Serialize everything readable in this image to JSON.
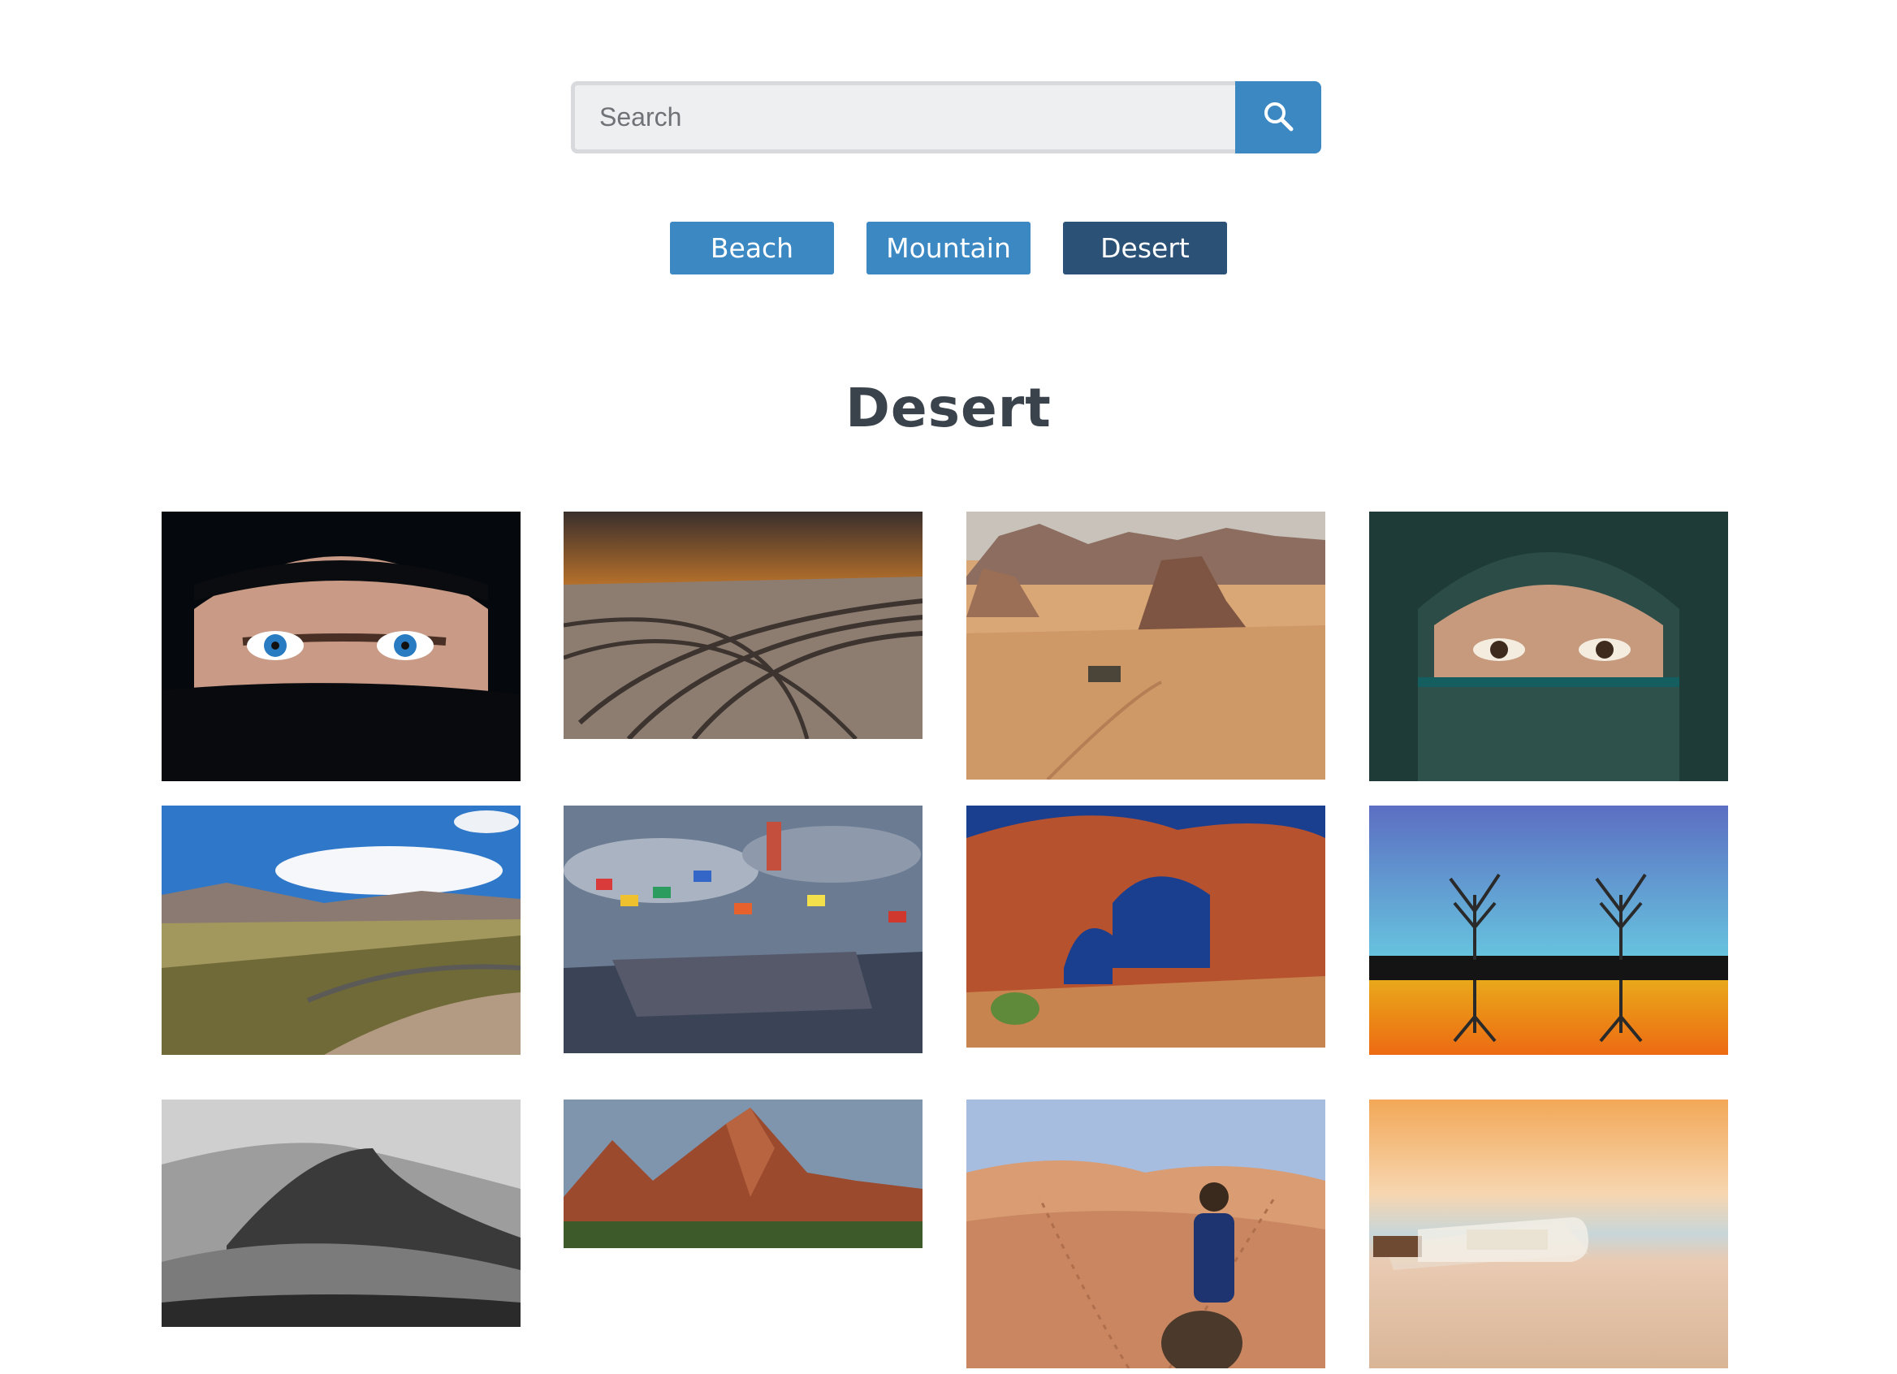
{
  "search": {
    "placeholder": "Search",
    "value": "",
    "icon": "search-icon"
  },
  "filters": [
    {
      "label": "Beach",
      "active": false
    },
    {
      "label": "Mountain",
      "active": false
    },
    {
      "label": "Desert",
      "active": true
    }
  ],
  "colors": {
    "primary": "#3b88c3",
    "active": "#2b5276",
    "heading": "#3a434c"
  },
  "gallery": {
    "title": "Desert",
    "photos": [
      {
        "name": "veiled-woman-blue-eyes"
      },
      {
        "name": "salt-flat-tire-tracks-sunset"
      },
      {
        "name": "wadi-rum-rock-formations"
      },
      {
        "name": "woman-green-niqab"
      },
      {
        "name": "andes-valley-road"
      },
      {
        "name": "salt-flat-flags-monument"
      },
      {
        "name": "red-rock-double-arch"
      },
      {
        "name": "tree-reflection-lake"
      },
      {
        "name": "black-white-sand-dunes"
      },
      {
        "name": "red-mountains-sunset"
      },
      {
        "name": "camel-rider-dunes"
      },
      {
        "name": "message-in-bottle-beach"
      }
    ]
  }
}
